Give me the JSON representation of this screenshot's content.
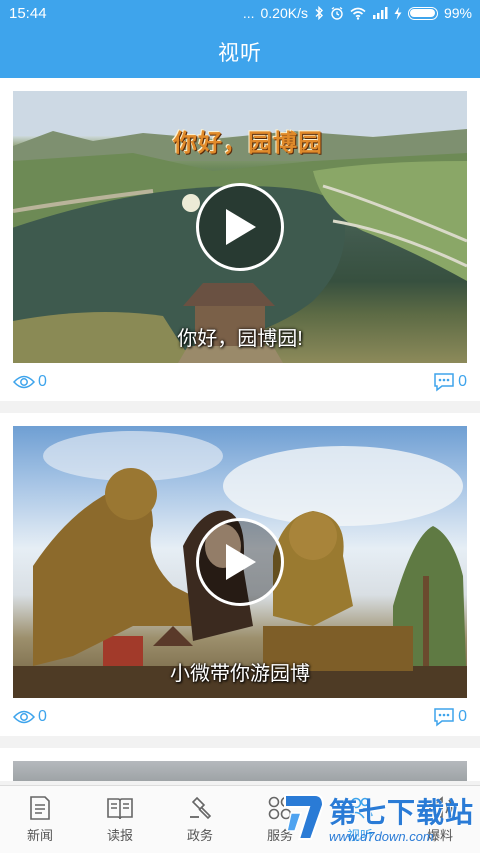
{
  "status_bar": {
    "time": "15:44",
    "dots": "...",
    "speed": "0.20K/s",
    "battery_text": "99%",
    "battery_level": 0.99
  },
  "header": {
    "title": "视听"
  },
  "feed": {
    "items": [
      {
        "overlay_title": "你好，园博园",
        "caption": "你好，园博园!",
        "views": "0",
        "comments": "0"
      },
      {
        "caption": "小微带你游园博",
        "views": "0",
        "comments": "0"
      }
    ]
  },
  "tabs": [
    {
      "label": "新闻",
      "icon": "newspaper-icon"
    },
    {
      "label": "读报",
      "icon": "book-icon"
    },
    {
      "label": "政务",
      "icon": "gavel-icon"
    },
    {
      "label": "服务",
      "icon": "grid-icon"
    },
    {
      "label": "视听",
      "icon": "people-icon"
    },
    {
      "label": "爆料",
      "icon": "speaker-icon"
    }
  ],
  "watermark": {
    "name": "第七下载站",
    "url": "www.d7down.com"
  },
  "colors": {
    "accent": "#3ea4ec"
  }
}
